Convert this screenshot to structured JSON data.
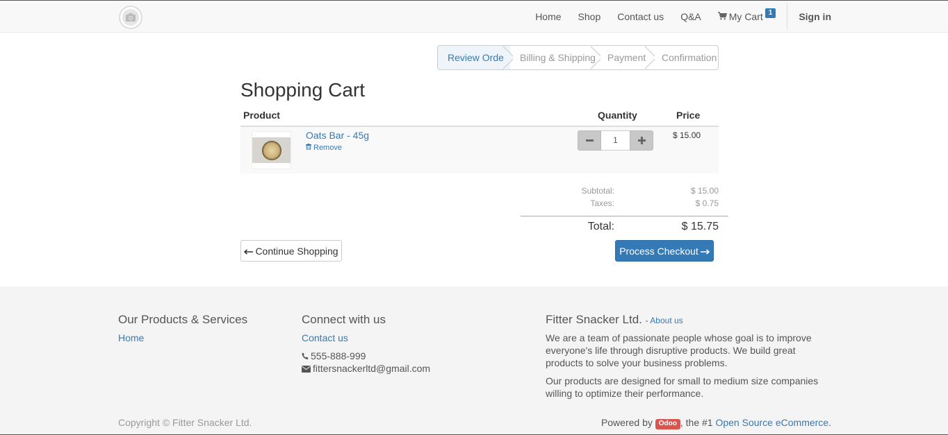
{
  "navbar": {
    "logo_icon": "camera-icon",
    "links": [
      {
        "label": "Home"
      },
      {
        "label": "Shop"
      },
      {
        "label": "Contact us"
      },
      {
        "label": "Q&A"
      }
    ],
    "cart": {
      "label": "My Cart",
      "count": "1",
      "icon": "shopping-cart-icon"
    },
    "signin_label": "Sign in"
  },
  "wizard": {
    "steps": [
      {
        "label": "Review Order",
        "active": true
      },
      {
        "label": "Billing & Shipping",
        "active": false
      },
      {
        "label": "Payment",
        "active": false
      },
      {
        "label": "Confirmation",
        "active": false
      }
    ]
  },
  "cart": {
    "title": "Shopping Cart",
    "columns": {
      "product": "Product",
      "quantity": "Quantity",
      "price": "Price"
    },
    "items": [
      {
        "name": "Oats Bar - 45g",
        "remove_label": "Remove",
        "quantity": "1",
        "price": "$ 15.00"
      }
    ],
    "summary": {
      "subtotal_label": "Subtotal:",
      "subtotal": "$ 15.00",
      "taxes_label": "Taxes:",
      "taxes": "$ 0.75",
      "total_label": "Total:",
      "total": "$ 15.75"
    },
    "continue_label": "Continue Shopping",
    "checkout_label": "Process Checkout"
  },
  "footer": {
    "products": {
      "title": "Our Products & Services",
      "links": [
        "Home"
      ]
    },
    "connect": {
      "title": "Connect with us",
      "contact_label": "Contact us",
      "phone": "555-888-999",
      "email": "fittersnackerltd@gmail.com"
    },
    "company": {
      "name": "Fitter Snacker Ltd.",
      "about_prefix": "- ",
      "about_label": "About us",
      "p1": "We are a team of passionate people whose goal is to improve everyone's life through disruptive products. We build great products to solve your business problems.",
      "p2": "Our products are designed for small to medium size companies willing to optimize their performance."
    },
    "copyright": "Copyright © Fitter Snacker Ltd.",
    "powered": {
      "prefix": "Powered by ",
      "badge": "Odoo",
      "middle": ", the #1 ",
      "link": "Open Source eCommerce",
      "suffix": "."
    }
  },
  "colors": {
    "primary": "#337ab7",
    "danger": "#d9534f",
    "muted": "#999999"
  }
}
